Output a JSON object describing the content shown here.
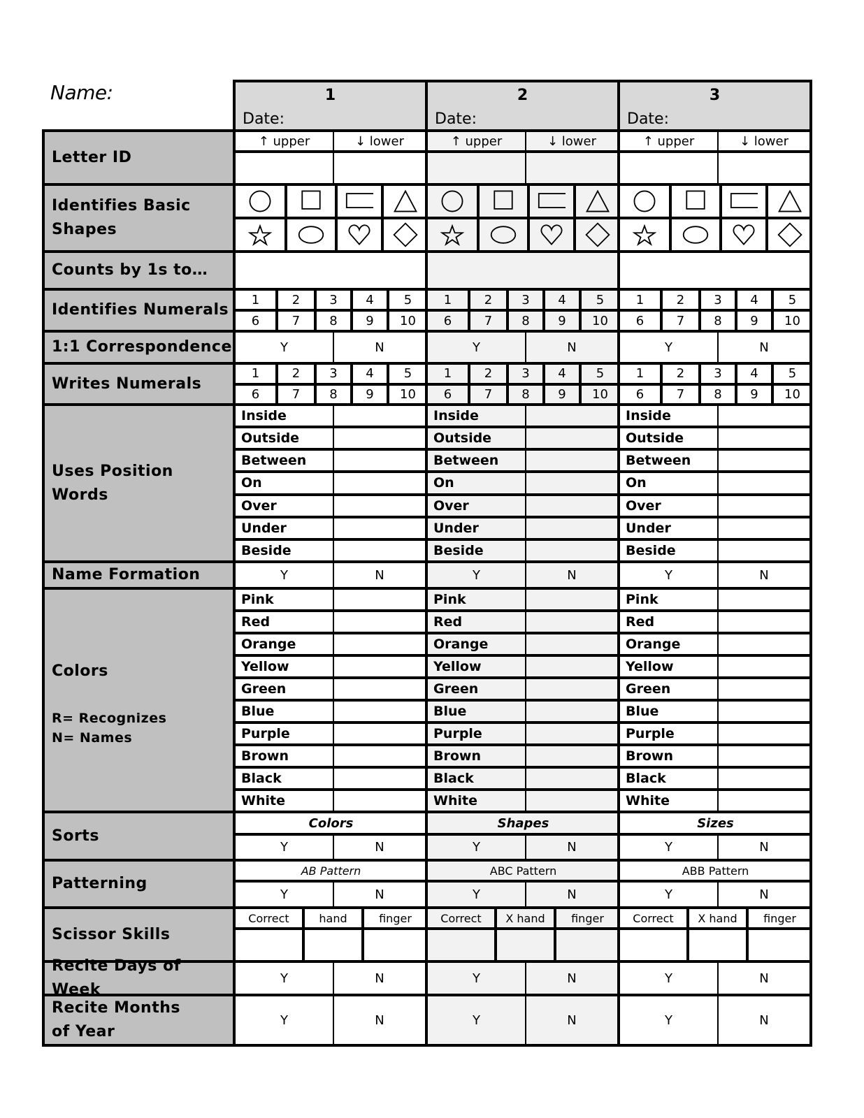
{
  "header": {
    "name_label": "Name:",
    "columns": [
      {
        "number": "1",
        "date_label": "Date:"
      },
      {
        "number": "2",
        "date_label": "Date:"
      },
      {
        "number": "3",
        "date_label": "Date:"
      }
    ]
  },
  "rows": {
    "letter_id": {
      "label": "Letter ID",
      "upper": "↑ upper",
      "lower": "↓ lower"
    },
    "shapes": {
      "label": "Identifies Basic Shapes",
      "icons": [
        "circle-icon",
        "square-icon",
        "rectangle-icon",
        "triangle-icon",
        "star-icon",
        "oval-icon",
        "heart-icon",
        "diamond-icon"
      ]
    },
    "counts": {
      "label": "Counts by 1s to…"
    },
    "identifies_numerals": {
      "label": "Identifies Numerals",
      "numbers": [
        "1",
        "2",
        "3",
        "4",
        "5",
        "6",
        "7",
        "8",
        "9",
        "10"
      ]
    },
    "correspondence": {
      "label": "1:1 Correspondence",
      "yes": "Y",
      "no": "N"
    },
    "writes_numerals": {
      "label": "Writes Numerals",
      "numbers": [
        "1",
        "2",
        "3",
        "4",
        "5",
        "6",
        "7",
        "8",
        "9",
        "10"
      ]
    },
    "position_words": {
      "label": "Uses Position Words",
      "words": [
        "Inside",
        "Outside",
        "Between",
        "On",
        "Over",
        "Under",
        "Beside"
      ]
    },
    "name_formation": {
      "label": "Name Formation",
      "yes": "Y",
      "no": "N"
    },
    "colors": {
      "label": "Colors",
      "legend_r": "R= Recognizes",
      "legend_n": "N= Names",
      "words": [
        "Pink",
        "Red",
        "Orange",
        "Yellow",
        "Green",
        "Blue",
        "Purple",
        "Brown",
        "Black",
        "White"
      ]
    },
    "sorts": {
      "label": "Sorts",
      "categories": [
        "Colors",
        "Shapes",
        "Sizes"
      ],
      "yes": "Y",
      "no": "N"
    },
    "patterning": {
      "label": "Patterning",
      "patterns": [
        "AB Pattern",
        "ABC Pattern",
        "ABB Pattern"
      ],
      "yes": "Y",
      "no": "N"
    },
    "scissor": {
      "label": "Scissor Skills",
      "headers": [
        [
          "Correct",
          "hand",
          "finger"
        ],
        [
          "Correct",
          "X hand",
          "finger"
        ],
        [
          "Correct",
          "X hand",
          "finger"
        ]
      ]
    },
    "days": {
      "label": "Recite Days of Week",
      "yes": "Y",
      "no": "N"
    },
    "months": {
      "label": "Recite Months of Year",
      "yes": "Y",
      "no": "N"
    }
  }
}
